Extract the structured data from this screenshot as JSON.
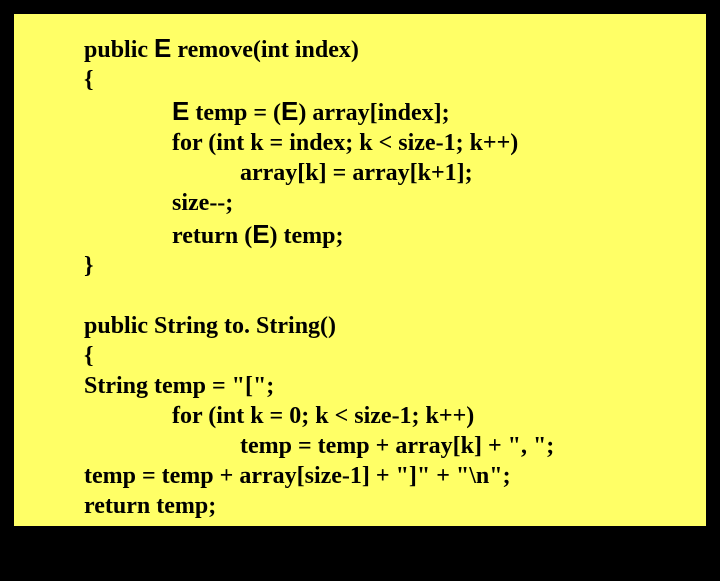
{
  "code": {
    "l1a": "public ",
    "l1_E": "E",
    "l1b": " remove(int index)",
    "l2": "{",
    "l3_E1": "E",
    "l3a": " temp = (",
    "l3_E2": "E",
    "l3b": ") array[index];",
    "l4": "for (int k = index; k < size-1; k++)",
    "l5": "array[k] = array[k+1];",
    "l6": "size--;",
    "l7a": "return (",
    "l7_E": "E",
    "l7b": ") temp;",
    "l8": "}",
    "blank": " ",
    "l9": "public String to. String()",
    "l10": "{",
    "l11": "String temp = \"[\";",
    "l12": "for (int k = 0; k < size-1; k++)",
    "l13": "temp = temp + array[k] + \", \";",
    "l14": "temp = temp + array[size-1] + \"]\" + \"\\n\";",
    "l15": "return temp;",
    "l16": "}",
    "l17": "}"
  }
}
